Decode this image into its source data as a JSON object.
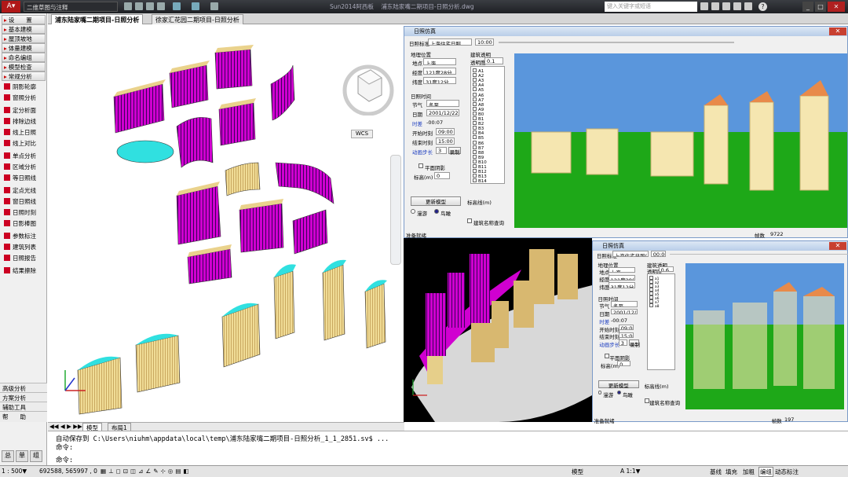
{
  "titlebar": {
    "workspace": "二维草图与注释",
    "app_name": "Sun2014阿西板",
    "doc_name": "浦东陆家嘴二期项目-日照分析.dwg",
    "search_placeholder": "键入关键字或短语",
    "help": "?"
  },
  "doc_tabs": [
    "浦东陆家嘴二期项目-日照分析",
    "徐家汇花园二期项目-日照分析"
  ],
  "left_panel": {
    "items": [
      {
        "label": "设　　置",
        "kind": "hdr"
      },
      {
        "label": "基本建模",
        "kind": "hdr"
      },
      {
        "label": "屋顶坡地",
        "kind": "hdr"
      },
      {
        "label": "体量建模",
        "kind": "hdr"
      },
      {
        "label": "命名编组",
        "kind": "hdr"
      },
      {
        "label": "模型检查",
        "kind": "hdr"
      },
      {
        "label": "常规分析",
        "kind": "hdr"
      },
      {
        "label": "阴影轮廓",
        "kind": "sub"
      },
      {
        "label": "窗照分析",
        "kind": "sub"
      },
      {
        "label": "定分析面",
        "kind": "sub"
      },
      {
        "label": "排除边线",
        "kind": "sub"
      },
      {
        "label": "线上日照",
        "kind": "sub"
      },
      {
        "label": "线上对比",
        "kind": "sub"
      },
      {
        "label": "单点分析",
        "kind": "sub"
      },
      {
        "label": "区域分析",
        "kind": "sub"
      },
      {
        "label": "等日照线",
        "kind": "sub"
      },
      {
        "label": "定点光线",
        "kind": "sub"
      },
      {
        "label": "窗日照线",
        "kind": "sub"
      },
      {
        "label": "日照时刻",
        "kind": "sub"
      },
      {
        "label": "日影棒图",
        "kind": "sub"
      },
      {
        "label": "参数标注",
        "kind": "sub"
      },
      {
        "label": "建筑列表",
        "kind": "sub"
      },
      {
        "label": "日照报告",
        "kind": "sub"
      },
      {
        "label": "结果擦除",
        "kind": "sub"
      }
    ],
    "bottom": [
      "高级分析",
      "方案分析",
      "辅助工具",
      "帮　　助"
    ],
    "vtabs": [
      "总",
      "单",
      "组"
    ]
  },
  "viewcube": {
    "wcs": "WCS"
  },
  "model_tabs": [
    "模型",
    "布局1"
  ],
  "command": {
    "line1": "自动保存到 C:\\Users\\niuhm\\appdata\\local\\temp\\浦东陆家嘴二期项目-日照分析_1_1_2851.sv$ ...",
    "line2": "命令:",
    "line3": "命令:"
  },
  "statusbar": {
    "scale": "1 : 500▼",
    "coords": "692588,  565997 , 0",
    "model": "模型",
    "anno": "A 1:1▼",
    "right_items": [
      "基线",
      "填充",
      "加粗",
      "编组",
      "动态标注"
    ]
  },
  "sim1": {
    "title": "日照仿真",
    "standard_label": "日照标准",
    "standard_value": "上海住宅日照",
    "time_value": "10:00",
    "location_group": "地理位置",
    "place_label": "地点",
    "place_value": "上海",
    "lon_label": "经度",
    "lon_value": "121度28分",
    "lat_label": "纬度",
    "lat_value": "31度12分",
    "time_group": "日照时间",
    "season_label": "节气",
    "season_value": "冬至",
    "date_label": "日期",
    "date_value": "2001/12/22",
    "timediff_label": "时差",
    "timediff_value": "-00:07",
    "start_label": "开始时刻",
    "start_value": "09:00",
    "end_label": "结束时刻",
    "end_value": "15:00",
    "step_label": "动画步长",
    "step_value": "3",
    "record_btn": "录制",
    "flat_shadow": "平面阴影",
    "elev_label": "标高(m)",
    "elev_value": "0",
    "update_btn": "更新模型",
    "baseline_label": "标高线(m)",
    "radio_roam": "漫游",
    "radio_bird": "鸟瞰",
    "name_query": "建筑名称查询",
    "transparency_group": "建筑透明",
    "transparency_label": "透明度",
    "transparency_value": "0.1",
    "building_list": [
      "A1",
      "A2",
      "A3",
      "A4",
      "A5",
      "A6",
      "A7",
      "A8",
      "A9",
      "B0",
      "B1",
      "B2",
      "B3",
      "B4",
      "B5",
      "B6",
      "B7",
      "B8",
      "B9",
      "B10",
      "B11",
      "B12",
      "B13",
      "B14"
    ],
    "status_left": "准备就绪",
    "status_right_label": "帧数",
    "status_right_value": "9722"
  },
  "sim2": {
    "title": "日照仿真",
    "standard_label": "日照标准",
    "standard_value": "上海住宅日照(4",
    "time_value": "00:00",
    "location_group": "地理位置",
    "place_label": "地点",
    "place_value": "上海",
    "lon_label": "经度",
    "lon_value": "121度28分",
    "lat_label": "纬度",
    "lat_value": "31度12分",
    "time_group": "日照时间",
    "season_label": "节气",
    "season_value": "冬至",
    "date_label": "日期",
    "date_value": "2001/12/22",
    "timediff_label": "时差",
    "timediff_value": "-00:07",
    "start_label": "开始时刻",
    "start_value": "09:00",
    "end_label": "结束时刻",
    "end_value": "15:00",
    "step_label": "动画步长",
    "step_value": "3",
    "record_btn": "录制",
    "flat_shadow": "平面阴影",
    "elev_label": "标高(m)",
    "elev_value": "0",
    "update_btn": "更新模型",
    "baseline_label": "标高线(m)",
    "radio_roam": "漫游",
    "radio_bird": "鸟瞰",
    "name_query": "建筑名称查询",
    "transparency_group": "建筑透明",
    "transparency_label": "透明度",
    "transparency_value": "0.6",
    "building_list": [
      "a1",
      "a2",
      "a3",
      "a4",
      "a5",
      "a6",
      "a7",
      "a8"
    ],
    "status_left": "准备就绪",
    "status_right_label": "帧数",
    "status_right_value": "197"
  },
  "colors": {
    "sky": "#5a96dc",
    "ground": "#1ea818",
    "building": "#f5e6b0",
    "roof": "#e88a4a",
    "magenta": "#e000e0",
    "cyan": "#20e0e0"
  }
}
